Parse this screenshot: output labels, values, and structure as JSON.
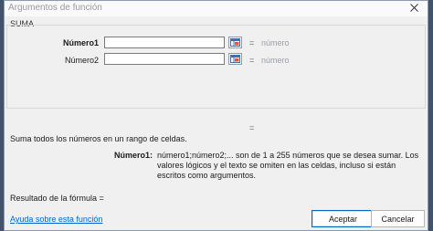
{
  "window": {
    "title": "Argumentos de función"
  },
  "function_name": "SUMA",
  "arguments": [
    {
      "label": "Número1",
      "value": "",
      "result": "número",
      "active": true
    },
    {
      "label": "Número2",
      "value": "",
      "result": "número",
      "active": false
    }
  ],
  "equals_sign": "=",
  "function_description": "Suma todos los números en un rango de celdas.",
  "argument_help": {
    "label": "Número1:",
    "text": "número1;número2;... son de 1 a 255 números que se desea sumar. Los valores lógicos y el texto se omiten en las celdas, incluso si están escritos como argumentos."
  },
  "formula_result_label": "Resultado de la fórmula =",
  "help_link": "Ayuda sobre esta función",
  "buttons": {
    "ok": "Aceptar",
    "cancel": "Cancelar"
  }
}
